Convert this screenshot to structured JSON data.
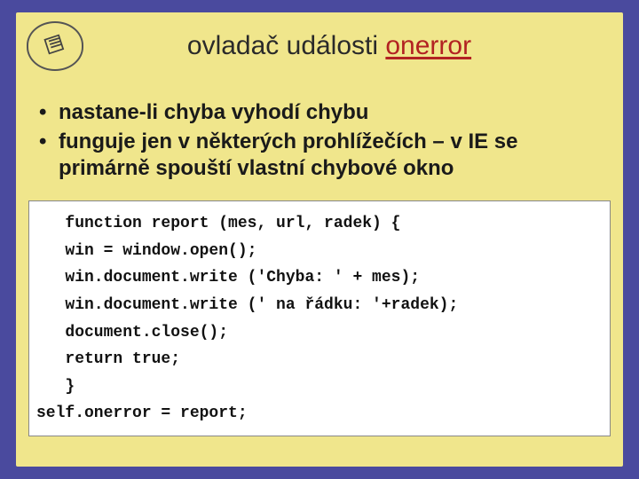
{
  "logo": {
    "name": "book-logo-icon"
  },
  "title": {
    "prefix": "ovladač události ",
    "keyword": "onerror"
  },
  "bullets": [
    "nastane-li chyba vyhodí chybu",
    "funguje jen v některých prohlížečích – v IE se primárně spouští vlastní chybové okno"
  ],
  "code": "   function report (mes, url, radek) {\n   win = window.open();\n   win.document.write ('Chyba: ' + mes);\n   win.document.write (' na řádku: '+radek);\n   document.close();\n   return true;\n   }\nself.onerror = report;"
}
